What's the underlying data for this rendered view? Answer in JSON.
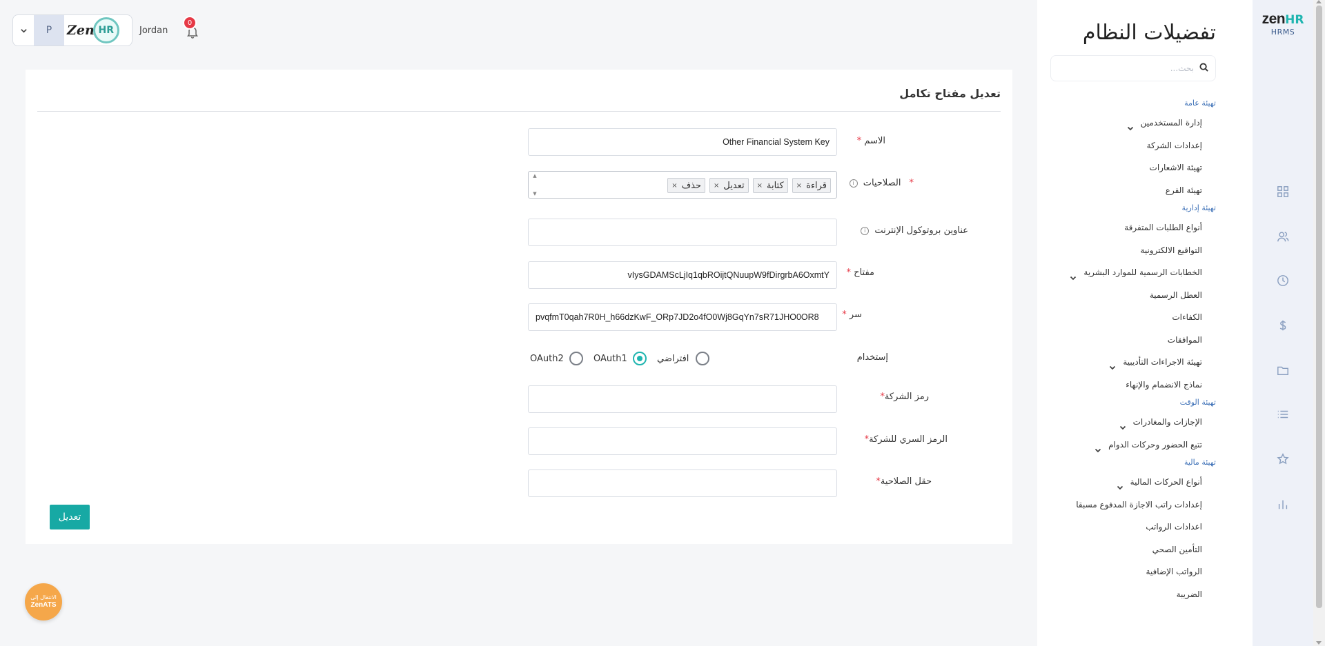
{
  "brand": {
    "zen": "zen",
    "hr": "HR",
    "sub": "HRMS"
  },
  "settings": {
    "title": "تفضيلات النظام",
    "search_placeholder": "بحث..."
  },
  "nav": {
    "sections": [
      {
        "label": "تهيئة عامة",
        "items": [
          {
            "label": "إدارة المستخدمين",
            "expandable": true
          },
          {
            "label": "إعدادات الشركة",
            "expandable": false
          },
          {
            "label": "تهيئة الاشعارات",
            "expandable": false
          },
          {
            "label": "تهيئة الفرع",
            "expandable": false
          }
        ]
      },
      {
        "label": "تهيئة إدارية",
        "items": [
          {
            "label": "أنواع الطلبات المتفرقة",
            "expandable": false
          },
          {
            "label": "التواقيع الالكترونية",
            "expandable": false
          },
          {
            "label": "الخطابات الرسمية للموارد البشرية",
            "expandable": true
          },
          {
            "label": "العطل الرسمية",
            "expandable": false
          },
          {
            "label": "الكفاءات",
            "expandable": false
          },
          {
            "label": "الموافقات",
            "expandable": false
          },
          {
            "label": "تهيئة الاجراءات التأديبية",
            "expandable": true
          },
          {
            "label": "نماذج الانضمام والإنهاء",
            "expandable": false
          }
        ]
      },
      {
        "label": "تهيئة الوقت",
        "items": [
          {
            "label": "الإجازات والمغادرات",
            "expandable": true
          },
          {
            "label": "تتبع الحضور وحركات الدوام",
            "expandable": true
          }
        ]
      },
      {
        "label": "تهيئة مالية",
        "items": [
          {
            "label": "أنواع الحركات المالية",
            "expandable": true
          },
          {
            "label": "إعدادات راتب الاجازة المدفوع مسبقا",
            "expandable": false
          },
          {
            "label": "اعدادات الرواتب",
            "expandable": false
          },
          {
            "label": "التأمين الصحي",
            "expandable": false
          },
          {
            "label": "الرواتب الإضافية",
            "expandable": false
          },
          {
            "label": "الضريبة",
            "expandable": false
          }
        ]
      }
    ]
  },
  "topbar": {
    "avatar_initial": "P",
    "company_logo_text": "Zen",
    "company_logo_hr": "HR",
    "country": "Jordan",
    "notifications_count": "0"
  },
  "form": {
    "title": "تعديل مفتاح تكامل",
    "name_label": "الاسم",
    "name_value": "Other Financial System Key",
    "permissions_label": "الصلاحيات",
    "permissions": [
      "قراءة",
      "كتابة",
      "تعديل",
      "حذف"
    ],
    "ip_label": "عناوين بروتوكول الإنترنت",
    "ip_value": "",
    "key_label": "مفتاح",
    "key_value": "vIysGDAMScLjIq1qbROijtQNuupW9fDirgrbA6OxmtY",
    "secret_label": "سر",
    "secret_value": "pvqfmT0qah7R0H_h66dzKwF_ORp7JD2o4fO0Wj8GqYn7sR71JHO0OR8",
    "usage_label": "إستخدام",
    "usage_options": [
      "افتراضي",
      "OAuth1",
      "OAuth2"
    ],
    "usage_selected": "OAuth1",
    "company_code_label": "رمز الشركة",
    "company_secret_label": "الرمز السري للشركة",
    "permission_field_label": "حقل الصلاحية",
    "required_mark": "*",
    "submit_label": "تعديل"
  },
  "ats": {
    "line1": "الانتقال إلى",
    "line2": "ZenATS"
  },
  "colors": {
    "accent": "#17a9a4",
    "section": "#3b6fb6",
    "badge": "#e63946",
    "ats": "#f5a74a"
  }
}
